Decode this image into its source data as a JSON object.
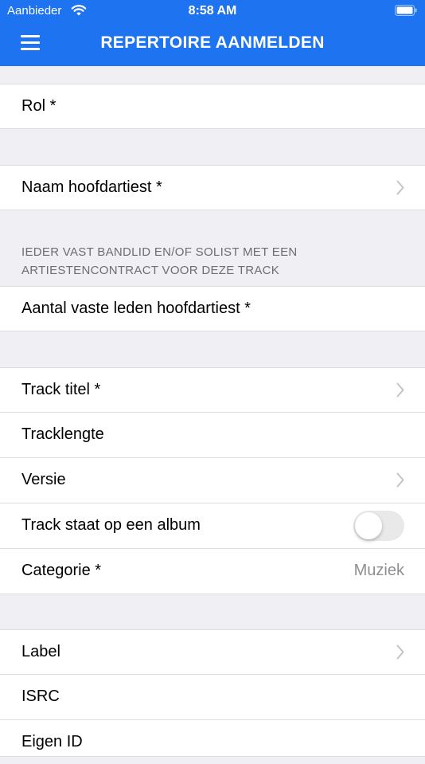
{
  "status": {
    "carrier": "Aanbieder",
    "time": "8:58 AM"
  },
  "nav": {
    "title": "REPERTOIRE AANMELDEN"
  },
  "rows": {
    "rol": "Rol *",
    "naam_hoofdartiest": "Naam hoofdartiest *",
    "section_note": "IEDER VAST BANDLID EN/OF SOLIST MET EEN ARTIESTENCONTRACT VOOR DEZE TRACK",
    "aantal_leden": "Aantal vaste leden hoofdartiest *",
    "track_titel": "Track titel *",
    "tracklengte": "Tracklengte",
    "versie": "Versie",
    "album_toggle": "Track staat op een album",
    "album_toggle_on": false,
    "categorie": "Categorie *",
    "categorie_value": "Muziek",
    "label": "Label",
    "isrc": "ISRC",
    "eigen_id": "Eigen ID"
  }
}
